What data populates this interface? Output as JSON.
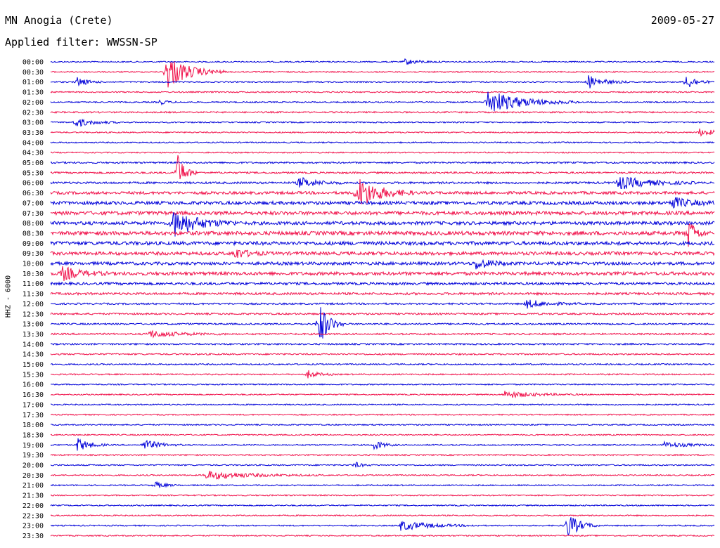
{
  "header": {
    "station": "MN Anogia (Crete)",
    "date": "2009-05-27",
    "filter": "Applied filter: WWSSN-SP"
  },
  "channel_label": "HHZ - 6000",
  "colors": {
    "trace_a": "#0000d8",
    "trace_b": "#f0104a",
    "text": "#000000",
    "background": "#ffffff"
  },
  "chart_data": {
    "type": "helicorder",
    "station": "MN Anogia (Crete)",
    "date": "2009-05-27",
    "filter": "WWSSN-SP",
    "channel": "HHZ - 6000",
    "row_minutes": 30,
    "rows": [
      "00:00",
      "00:30",
      "01:00",
      "01:30",
      "02:00",
      "02:30",
      "03:00",
      "03:30",
      "04:00",
      "04:30",
      "05:00",
      "05:30",
      "06:00",
      "06:30",
      "07:00",
      "07:30",
      "08:00",
      "08:30",
      "09:00",
      "09:30",
      "10:00",
      "10:30",
      "11:00",
      "11:30",
      "12:00",
      "12:30",
      "13:00",
      "13:30",
      "14:00",
      "14:30",
      "15:00",
      "15:30",
      "16:00",
      "16:30",
      "17:00",
      "17:30",
      "18:00",
      "18:30",
      "19:00",
      "19:30",
      "20:00",
      "20:30",
      "21:00",
      "21:30",
      "22:00",
      "22:30",
      "23:00",
      "23:30"
    ],
    "row_colors": [
      "blue",
      "red"
    ],
    "noise_level": [
      1,
      1,
      1,
      1,
      1,
      1.2,
      1,
      1,
      1,
      1,
      1.3,
      1.4,
      1.6,
      2.2,
      2.6,
      2.8,
      2.6,
      3,
      2.8,
      2.6,
      2.4,
      2.6,
      2,
      1.8,
      1.4,
      1.4,
      1.3,
      1.3,
      1.3,
      1.2,
      1.1,
      1.1,
      1,
      1,
      1,
      1,
      1,
      1,
      1,
      1,
      1,
      1,
      1,
      1,
      1,
      1,
      1,
      1
    ],
    "events": [
      {
        "row": "00:00",
        "minute": 16.0,
        "amplitude": 4,
        "duration": 0.6
      },
      {
        "row": "00:30",
        "minute": 5.2,
        "amplitude": 26,
        "duration": 0.9
      },
      {
        "row": "01:00",
        "minute": 1.2,
        "amplitude": 7,
        "duration": 0.4
      },
      {
        "row": "01:00",
        "minute": 24.3,
        "amplitude": 10,
        "duration": 0.6
      },
      {
        "row": "01:00",
        "minute": 28.7,
        "amplitude": 12,
        "duration": 0.4
      },
      {
        "row": "02:00",
        "minute": 19.7,
        "amplitude": 18,
        "duration": 1.4
      },
      {
        "row": "02:00",
        "minute": 4.9,
        "amplitude": 4,
        "duration": 0.3
      },
      {
        "row": "03:00",
        "minute": 1.1,
        "amplitude": 7,
        "duration": 0.7
      },
      {
        "row": "03:30",
        "minute": 29.3,
        "amplitude": 5,
        "duration": 0.8
      },
      {
        "row": "05:30",
        "minute": 5.7,
        "amplitude": 30,
        "duration": 0.3
      },
      {
        "row": "06:00",
        "minute": 11.2,
        "amplitude": 8,
        "duration": 0.7
      },
      {
        "row": "06:00",
        "minute": 25.6,
        "amplitude": 10,
        "duration": 1.2
      },
      {
        "row": "06:30",
        "minute": 13.8,
        "amplitude": 24,
        "duration": 0.9
      },
      {
        "row": "07:00",
        "minute": 28.0,
        "amplitude": 9,
        "duration": 0.7
      },
      {
        "row": "08:00",
        "minute": 5.5,
        "amplitude": 20,
        "duration": 1.0
      },
      {
        "row": "08:30",
        "minute": 28.8,
        "amplitude": 22,
        "duration": 0.3
      },
      {
        "row": "09:30",
        "minute": 8.3,
        "amplitude": 8,
        "duration": 0.5
      },
      {
        "row": "10:00",
        "minute": 19.2,
        "amplitude": 8,
        "duration": 0.6
      },
      {
        "row": "10:30",
        "minute": 0.5,
        "amplitude": 10,
        "duration": 0.7
      },
      {
        "row": "12:00",
        "minute": 21.5,
        "amplitude": 6,
        "duration": 0.8
      },
      {
        "row": "13:00",
        "minute": 12.1,
        "amplitude": 35,
        "duration": 0.4
      },
      {
        "row": "13:30",
        "minute": 4.4,
        "amplitude": 5,
        "duration": 1.2
      },
      {
        "row": "15:30",
        "minute": 11.6,
        "amplitude": 6,
        "duration": 0.4
      },
      {
        "row": "16:30",
        "minute": 20.5,
        "amplitude": 5,
        "duration": 1.2
      },
      {
        "row": "19:00",
        "minute": 1.2,
        "amplitude": 10,
        "duration": 0.5
      },
      {
        "row": "19:00",
        "minute": 4.2,
        "amplitude": 8,
        "duration": 0.6
      },
      {
        "row": "19:00",
        "minute": 14.6,
        "amplitude": 7,
        "duration": 0.4
      },
      {
        "row": "19:00",
        "minute": 27.7,
        "amplitude": 4,
        "duration": 1.0
      },
      {
        "row": "20:00",
        "minute": 13.7,
        "amplitude": 5,
        "duration": 0.3
      },
      {
        "row": "20:30",
        "minute": 7.0,
        "amplitude": 6,
        "duration": 1.8
      },
      {
        "row": "21:00",
        "minute": 4.7,
        "amplitude": 5,
        "duration": 0.4
      },
      {
        "row": "23:00",
        "minute": 15.8,
        "amplitude": 7,
        "duration": 1.2
      },
      {
        "row": "23:00",
        "minute": 23.3,
        "amplitude": 20,
        "duration": 0.5
      }
    ]
  }
}
